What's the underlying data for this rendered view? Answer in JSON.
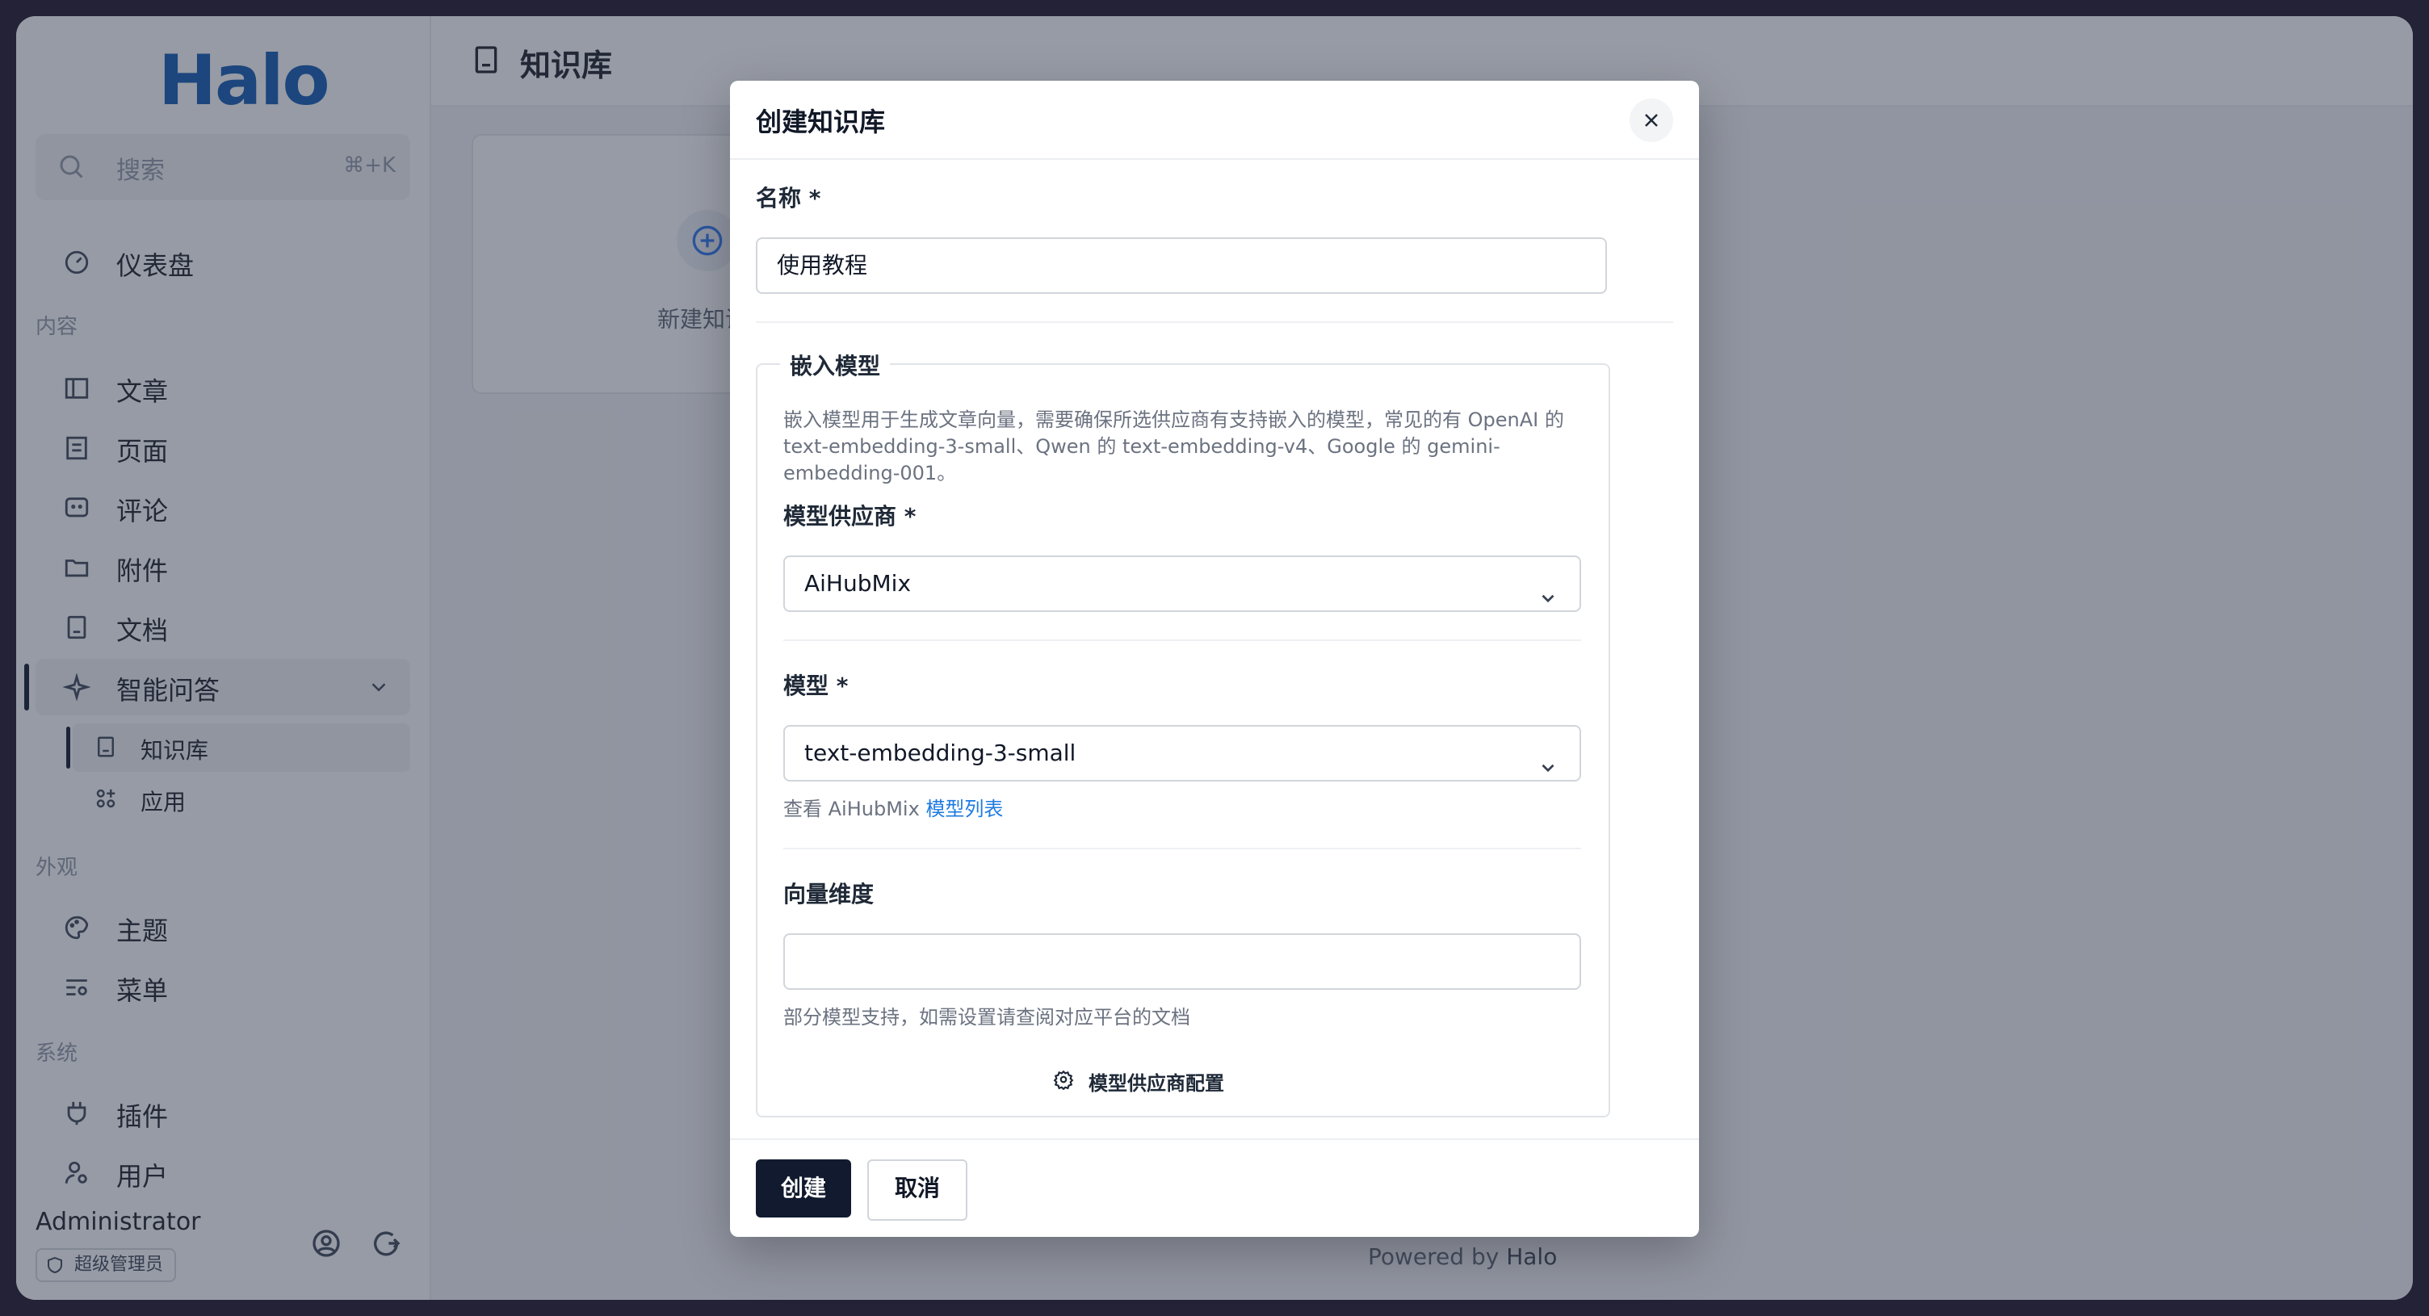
{
  "sidebar": {
    "logo": "Halo",
    "search": {
      "placeholder": "搜索",
      "shortcut": "⌘+K"
    },
    "dashboard": "仪表盘",
    "sections": {
      "content": "内容",
      "appearance": "外观",
      "system": "系统"
    },
    "content_items": [
      "文章",
      "页面",
      "评论",
      "附件",
      "文档"
    ],
    "ai": {
      "label": "智能问答",
      "children": [
        "知识库",
        "应用"
      ]
    },
    "appearance_items": [
      "主题",
      "菜单"
    ],
    "system_items": [
      "插件",
      "用户"
    ],
    "user": {
      "name": "Administrator",
      "role": "超级管理员"
    }
  },
  "header": {
    "title": "知识库"
  },
  "main": {
    "new_card_label": "新建知识库",
    "powered_prefix": "Powered by",
    "powered_brand": "Halo"
  },
  "modal": {
    "title": "创建知识库",
    "name_label": "名称 *",
    "name_value": "使用教程",
    "embed_legend": "嵌入模型",
    "embed_help_1": "嵌入模型用于生成文章向量，需要确保所选供应商有支持嵌入的模型，常见的有 OpenAI 的",
    "embed_help_2": "text-embedding-3-small、Qwen 的 text-embedding-v4、Google 的 gemini-",
    "embed_help_3": "embedding-001。",
    "provider_label": "模型供应商 *",
    "provider_value": "AiHubMix",
    "model_label": "模型 *",
    "model_value": "text-embedding-3-small",
    "model_help_prefix": "查看 AiHubMix",
    "model_help_link": "模型列表",
    "dim_label": "向量维度",
    "dim_value": "",
    "dim_help": "部分模型支持，如需设置请查阅对应平台的文档",
    "provider_config": "模型供应商配置",
    "create_button": "创建",
    "cancel_button": "取消"
  }
}
